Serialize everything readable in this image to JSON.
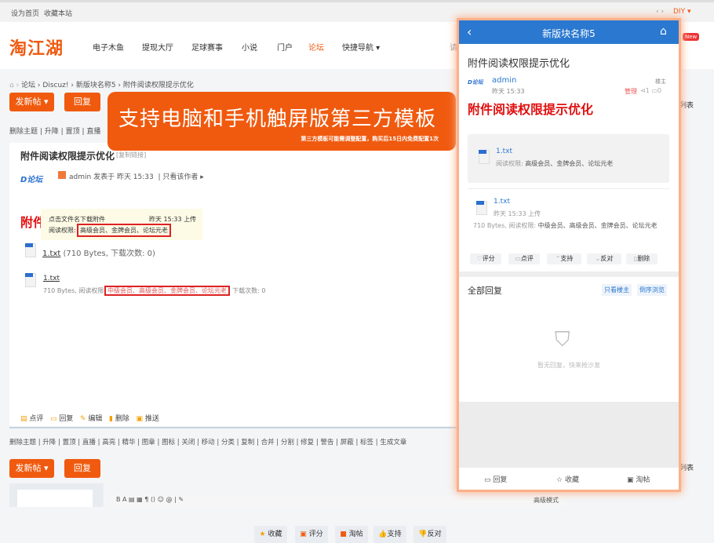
{
  "topbar": {
    "set_home": "设为首页",
    "bookmark": "收藏本站",
    "diy": "DIY ▾",
    "arrows": "‹ ›"
  },
  "header": {
    "logo": "淘江湖",
    "nav": [
      "电子木鱼",
      "提现大厅",
      "足球赛事",
      "小说",
      "门户",
      "论坛",
      "快捷导航 ▾"
    ],
    "active_nav": "论坛",
    "search_stub": "请"
  },
  "breadcrumb": [
    "论坛",
    "Discuz!",
    "新版块名称5",
    "附件阅读权限提示优化"
  ],
  "buttons": {
    "new_post": "发新帖 ▾",
    "reply": "回复"
  },
  "banner": {
    "title": "支持电脑和手机触屏版第三方模板",
    "subtitle": "第三方模板可能需调整配置，购买后15日内免费配置1次"
  },
  "mod_top": [
    "删除主题",
    "升降",
    "置顶",
    "直播"
  ],
  "post": {
    "title": "附件阅读权限提示优化",
    "copy_link": "[复制链接]",
    "author": "admin",
    "posted": "发表于 昨天 15:33",
    "only_author": "只看该作者 ▸",
    "red_title_partial": "附件",
    "tooltip": {
      "line1": "点击文件名下载附件",
      "time": "昨天 15:33 上传",
      "perm_label": "阅读权限:",
      "perm": "高级会员、金牌会员、论坛元老"
    },
    "att1": {
      "name": "1.txt",
      "meta": "(710 Bytes, 下载次数: 0)"
    },
    "att2": {
      "name": "1.txt",
      "meta_prefix": "710 Bytes, 阅读权限:",
      "perm": "中级会员、高级会员、金牌会员、论坛元老",
      "meta_suffix": ", 下载次数: 0"
    },
    "actions": [
      "收藏",
      "评分",
      "淘帖",
      "支持",
      "反对"
    ],
    "footer_links": [
      "点评",
      "回复",
      "编辑",
      "删除",
      "推送"
    ]
  },
  "mod_bottom": [
    "删除主题",
    "升降",
    "置顶",
    "直播",
    "高亮",
    "精华",
    "图章",
    "图标",
    "关闭",
    "移动",
    "分类",
    "复制",
    "合并",
    "分割",
    "修复",
    "警告",
    "屏蔽",
    "标签",
    "生成文章"
  ],
  "right": {
    "new_badge": "New",
    "list": "列表",
    "list2": "列表",
    "advanced": "高级模式"
  },
  "phone": {
    "title": "新版块名称5",
    "post_title": "附件阅读权限提示优化",
    "author": "admin",
    "time": "昨天 15:33",
    "floor": "楼主",
    "manage": "管理",
    "views": "1",
    "comments": "0",
    "red_title": "附件阅读权限提示优化",
    "att1": {
      "name": "1.txt",
      "perm_label": "阅读权限:",
      "perm": "高级会员、金牌会员、论坛元老"
    },
    "att2": {
      "name": "1.txt",
      "time": "昨天 15:33 上传",
      "meta": "710 Bytes, 阅读权限:",
      "perm": "中级会员、高级会员、金牌会员、论坛元老"
    },
    "actions": [
      "评分",
      "点评",
      "支持",
      "反对",
      "删除"
    ],
    "all_replies": "全部回复",
    "only_op": "只看楼主",
    "reverse": "倒序浏览",
    "empty": "暂无回复，快来抢沙发",
    "bottom": [
      "回复",
      "收藏",
      "淘帖"
    ]
  },
  "colors": {
    "accent": "#f05a0f",
    "phone_header": "#2a78d0",
    "red": "#e01010"
  }
}
